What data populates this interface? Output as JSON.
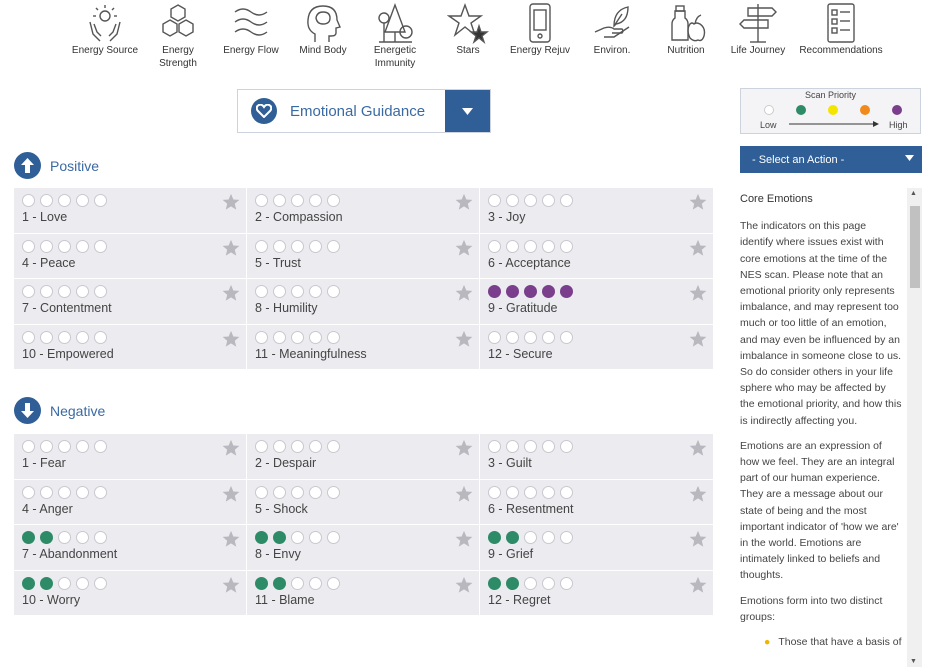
{
  "nav": [
    {
      "label": "Energy Source",
      "icon": "hands-sun-icon"
    },
    {
      "label": "Energy Strength",
      "icon": "hexagons-icon"
    },
    {
      "label": "Energy Flow",
      "icon": "waves-icon"
    },
    {
      "label": "Mind Body",
      "icon": "head-brain-icon"
    },
    {
      "label": "Energetic Immunity",
      "icon": "trees-icon"
    },
    {
      "label": "Stars",
      "icon": "stars-icon"
    },
    {
      "label": "Energy Rejuv",
      "icon": "phone-icon"
    },
    {
      "label": "Environ.",
      "icon": "hand-leaf-icon"
    },
    {
      "label": "Nutrition",
      "icon": "fruit-icon"
    },
    {
      "label": "Life Journey",
      "icon": "signpost-icon"
    },
    {
      "label": "Recommendations",
      "icon": "checklist-icon"
    }
  ],
  "dropdown": {
    "label": "Emotional Guidance",
    "icon": "heart-icon"
  },
  "positive": {
    "title": "Positive",
    "items": [
      {
        "label": "1 - Love",
        "level": 0,
        "color": ""
      },
      {
        "label": "2 - Compassion",
        "level": 0,
        "color": ""
      },
      {
        "label": "3 - Joy",
        "level": 0,
        "color": ""
      },
      {
        "label": "4 - Peace",
        "level": 0,
        "color": ""
      },
      {
        "label": "5 - Trust",
        "level": 0,
        "color": ""
      },
      {
        "label": "6 - Acceptance",
        "level": 0,
        "color": ""
      },
      {
        "label": "7 - Contentment",
        "level": 0,
        "color": ""
      },
      {
        "label": "8 - Humility",
        "level": 0,
        "color": ""
      },
      {
        "label": "9 - Gratitude",
        "level": 5,
        "color": "purple"
      },
      {
        "label": "10 - Empowered",
        "level": 0,
        "color": ""
      },
      {
        "label": "11 - Meaningfulness",
        "level": 0,
        "color": ""
      },
      {
        "label": "12 - Secure",
        "level": 0,
        "color": ""
      }
    ]
  },
  "negative": {
    "title": "Negative",
    "items": [
      {
        "label": "1 - Fear",
        "level": 0,
        "color": ""
      },
      {
        "label": "2 - Despair",
        "level": 0,
        "color": ""
      },
      {
        "label": "3 - Guilt",
        "level": 0,
        "color": ""
      },
      {
        "label": "4 - Anger",
        "level": 0,
        "color": ""
      },
      {
        "label": "5 - Shock",
        "level": 0,
        "color": ""
      },
      {
        "label": "6 - Resentment",
        "level": 0,
        "color": ""
      },
      {
        "label": "7 - Abandonment",
        "level": 2,
        "color": "green"
      },
      {
        "label": "8 - Envy",
        "level": 2,
        "color": "green"
      },
      {
        "label": "9 - Grief",
        "level": 2,
        "color": "green"
      },
      {
        "label": "10 - Worry",
        "level": 2,
        "color": "green"
      },
      {
        "label": "11 - Blame",
        "level": 2,
        "color": "green"
      },
      {
        "label": "12 - Regret",
        "level": 2,
        "color": "green"
      }
    ]
  },
  "legend": {
    "title": "Scan Priority",
    "low": "Low",
    "high": "High",
    "colors": [
      "#ffffff",
      "#2e8b67",
      "#f5e400",
      "#f08a1c",
      "#7a3e8c"
    ]
  },
  "action": {
    "label": "- Select an Action -"
  },
  "info": {
    "heading": "Core Emotions",
    "p1": "The indicators on this page identify where issues exist with core emotions at the time of the NES scan. Please note that an emotional priority only represents imbalance, and may represent too much or too little of an emotion, and may even be influenced by an imbalance in someone close to us. So do consider others in your life sphere who may be affected by the emotional priority, and how this is indirectly affecting you.",
    "p2": "Emotions are an expression of how we feel. They are an integral part of our human experience. They are a message about our state of being and the most important indicator of 'how we are' in the world. Emotions are intimately linked to beliefs and thoughts.",
    "p3": "Emotions form into two distinct groups:",
    "bullet1": "Those that have a basis of"
  },
  "colors": {
    "accent": "#2f5f96",
    "green": "#2e8b67",
    "purple": "#7a3e8c",
    "cell": "#ebebf0"
  }
}
